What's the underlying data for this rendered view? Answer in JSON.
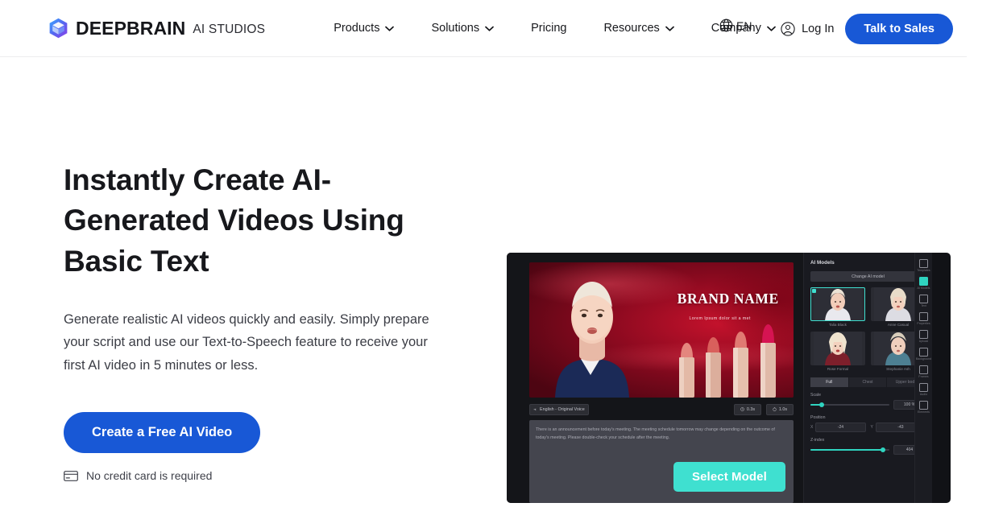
{
  "brand": {
    "name": "DEEPBRAIN",
    "sub": "AI STUDIOS",
    "logo_icon": "cube-logo-icon"
  },
  "header": {
    "nav": [
      {
        "label": "Products",
        "has_caret": true,
        "icon": "chevron-down-icon"
      },
      {
        "label": "Solutions",
        "has_caret": true,
        "icon": "chevron-down-icon"
      },
      {
        "label": "Pricing",
        "has_caret": false,
        "icon": ""
      },
      {
        "label": "Resources",
        "has_caret": true,
        "icon": "chevron-down-icon"
      },
      {
        "label": "Company",
        "has_caret": true,
        "icon": "chevron-down-icon"
      }
    ],
    "language": {
      "label": "EN",
      "icon": "globe-icon"
    },
    "login": {
      "label": "Log In",
      "icon": "user-circle-icon"
    },
    "cta": {
      "label": "Talk to Sales"
    }
  },
  "hero": {
    "title": "Instantly Create AI-Generated Videos Using Basic Text",
    "subtitle": "Generate realistic AI videos quickly and easily. Simply prepare your script and use our Text-to-Speech feature to receive your first AI video in 5 minutes or less.",
    "cta": {
      "label": "Create a Free AI Video"
    },
    "note": {
      "label": "No credit card is required",
      "icon": "credit-card-icon"
    }
  },
  "demo": {
    "stage": {
      "brand_name": "BRAND NAME",
      "brand_tagline": "Lorem Ipsum dolor sit a met"
    },
    "toolbar": {
      "voice_chip": {
        "label": "English - Original Voice",
        "icon": "voice-icon"
      },
      "speed_chip": {
        "label": "0.3s",
        "icon": "clock-icon"
      },
      "duration_chip": {
        "label": "1.0s",
        "icon": "timer-icon"
      }
    },
    "script": "There is an announcement before today's meeting. The meeting schedule tomorrow may change depending on the outcome of today's meeting. Please double-check your schedule after the meeting.",
    "select_model_button": {
      "label": "Select Model"
    },
    "panel": {
      "title": "AI Models",
      "change_button": {
        "label": "Change AI model"
      },
      "models": [
        {
          "name": "Talia Black",
          "selected": true
        },
        {
          "name": "Anne Casual",
          "selected": false
        },
        {
          "name": "Rose Formal",
          "selected": false
        },
        {
          "name": "Stephanie Ash",
          "selected": false
        }
      ],
      "segments": [
        {
          "label": "Full",
          "active": true
        },
        {
          "label": "Chest",
          "active": false
        },
        {
          "label": "Upper body",
          "active": false
        }
      ],
      "controls": [
        {
          "label": "Scale",
          "value": "100 %",
          "pct": 14
        },
        {
          "label": "Z-index",
          "value": "404",
          "pct": 92
        }
      ],
      "position": {
        "label": "Position",
        "fields": [
          {
            "key": "X",
            "value": "-24"
          },
          {
            "key": "Y",
            "value": "-43"
          }
        ]
      }
    },
    "rail": [
      {
        "label": "Templates",
        "icon": "templates-icon",
        "active": false
      },
      {
        "label": "AI Models",
        "icon": "ai-model-icon",
        "active": true
      },
      {
        "label": "Text",
        "icon": "text-icon",
        "active": false
      },
      {
        "label": "Properties",
        "icon": "properties-icon",
        "active": false
      },
      {
        "label": "Upload",
        "icon": "upload-icon",
        "active": false
      },
      {
        "label": "Background",
        "icon": "background-icon",
        "active": false
      },
      {
        "label": "Frames",
        "icon": "frames-icon",
        "active": false
      },
      {
        "label": "Audio",
        "icon": "audio-icon",
        "active": false
      },
      {
        "label": "Elements",
        "icon": "elements-icon",
        "active": false
      }
    ]
  },
  "colors": {
    "brand_blue": "#1858d6",
    "accent_teal": "#3fe0d0",
    "text_dark": "#17181c"
  }
}
